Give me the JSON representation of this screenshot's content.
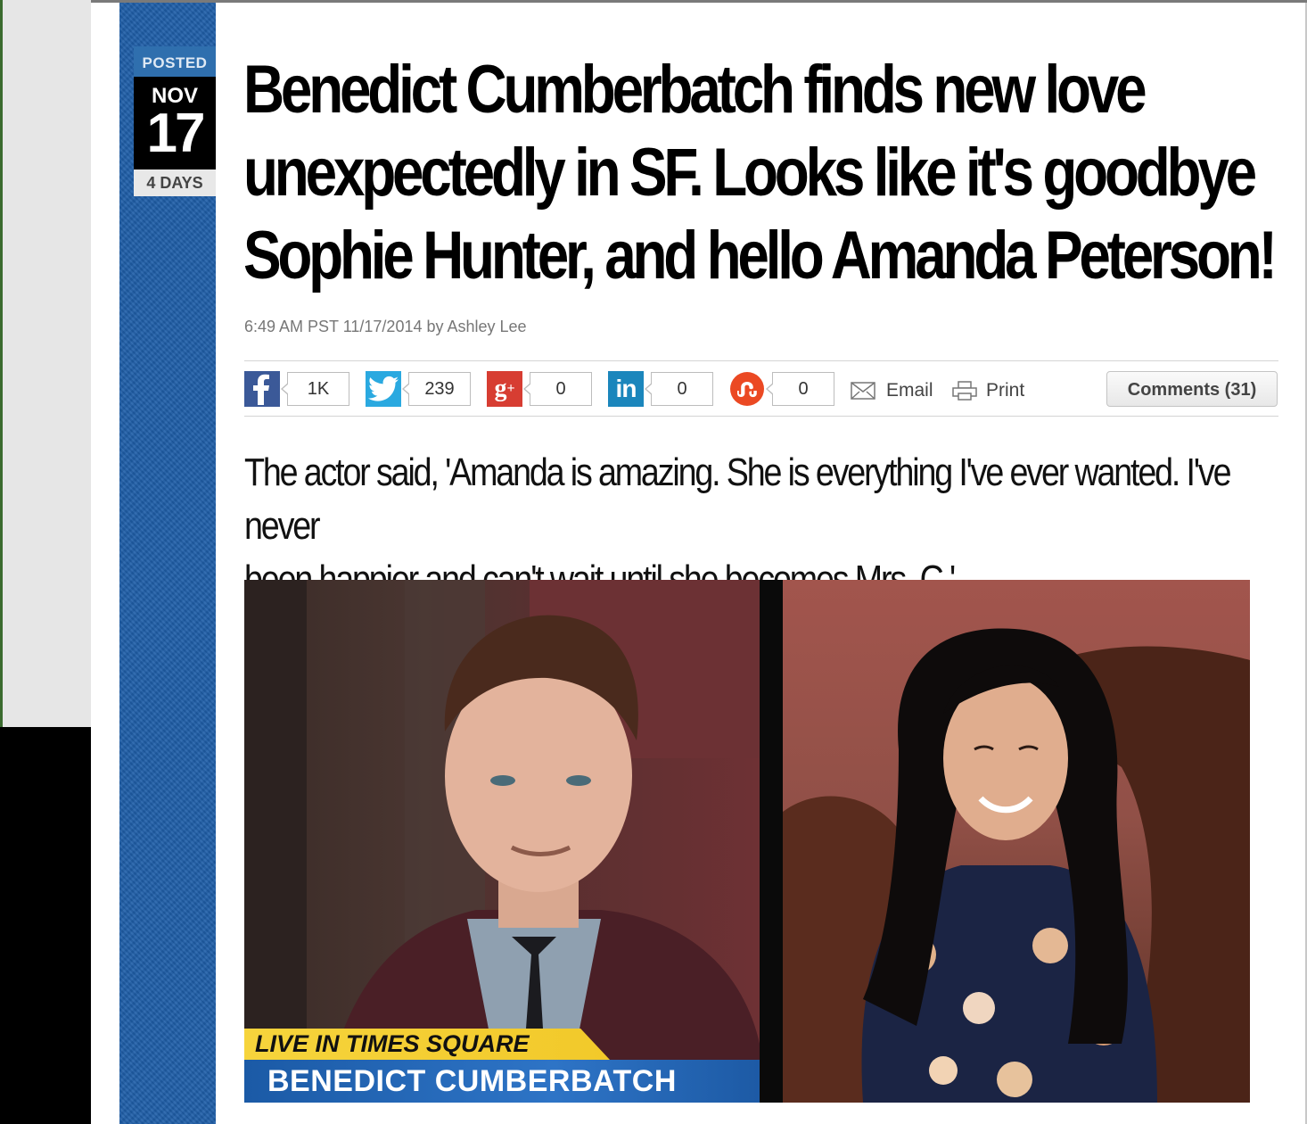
{
  "post_date": {
    "posted_label": "POSTED",
    "month": "NOV",
    "day": "17",
    "ago": "4 DAYS"
  },
  "article": {
    "headline_lines": [
      "Benedict Cumberbatch finds new love",
      "unexpectedly in SF. Looks like it's goodbye",
      "Sophie Hunter, and hello Amanda Peterson!"
    ],
    "byline": "6:49 AM PST 11/17/2014 by Ashley Lee",
    "deck_lines": [
      "The actor said, 'Amanda is amazing. She is everything I've ever wanted. I've never",
      "been happier and can't wait until she becomes Mrs. C.'"
    ]
  },
  "share_bar": {
    "facebook": {
      "icon": "facebook-icon",
      "count": "1K",
      "color": "#3b5998"
    },
    "twitter": {
      "icon": "twitter-icon",
      "count": "239",
      "color": "#2aa9e0"
    },
    "googleplus": {
      "icon": "google-plus-icon",
      "count": "0",
      "color": "#d73d32"
    },
    "linkedin": {
      "icon": "linkedin-icon",
      "count": "0",
      "color": "#1b86bc"
    },
    "stumbleupon": {
      "icon": "stumbleupon-icon",
      "count": "0",
      "color": "#eb4923"
    },
    "email_label": "Email",
    "print_label": "Print",
    "comments_label": "Comments (31)"
  },
  "photo": {
    "chyron_top": "LIVE IN TIMES SQUARE",
    "chyron_bottom": "BENEDICT CUMBERBATCH"
  },
  "colors": {
    "sidebar_blue": "#1f5fa9",
    "posted_blue": "#2f6fae",
    "chyron_yellow": "#f6d43c",
    "chyron_blue": "#1b5aa6"
  }
}
